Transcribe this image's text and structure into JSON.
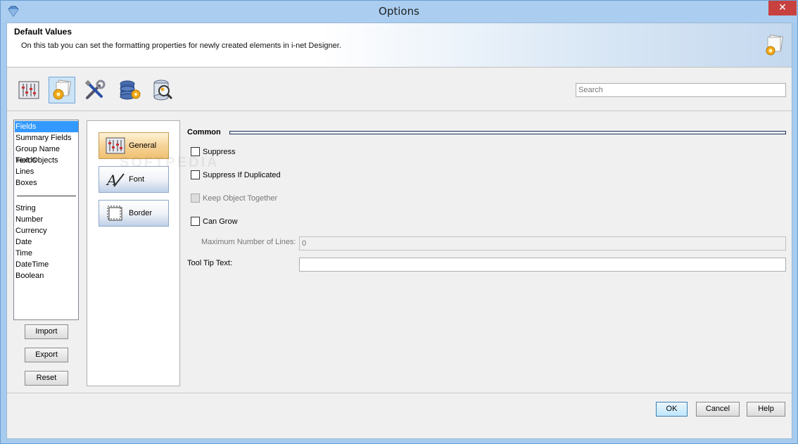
{
  "window": {
    "title": "Options",
    "close_glyph": "✕"
  },
  "header": {
    "title": "Default Values",
    "description": "On this tab you can set the formatting properties for newly created elements in i-net Designer."
  },
  "toolbar": {
    "icons": [
      {
        "name": "sliders-icon",
        "selected": false
      },
      {
        "name": "default-values-gear-icon",
        "selected": true
      },
      {
        "name": "tools-icon",
        "selected": false
      },
      {
        "name": "database-gear-icon",
        "selected": false
      },
      {
        "name": "database-search-icon",
        "selected": false
      }
    ],
    "search_placeholder": "Search"
  },
  "element_list": {
    "items": [
      "Fields",
      "Summary Fields",
      "Group Name Fields",
      "Text Objects",
      "Lines",
      "Boxes"
    ],
    "types": [
      "String",
      "Number",
      "Currency",
      "Date",
      "Time",
      "DateTime",
      "Boolean"
    ],
    "selected": "Fields"
  },
  "list_buttons": {
    "import": "Import",
    "export": "Export",
    "reset": "Reset"
  },
  "categories": [
    {
      "label": "General",
      "icon": "sliders-icon",
      "selected": true
    },
    {
      "label": "Font",
      "icon": "font-icon",
      "selected": false
    },
    {
      "label": "Border",
      "icon": "border-icon",
      "selected": false
    }
  ],
  "common": {
    "section_title": "Common",
    "suppress": "Suppress",
    "suppress_if_duplicated": "Suppress If Duplicated",
    "keep_object_together": "Keep Object Together",
    "can_grow": "Can Grow",
    "max_lines_label": "Maximum Number of Lines:",
    "max_lines_value": "0",
    "tooltip_label": "Tool Tip Text:",
    "tooltip_value": ""
  },
  "footer": {
    "ok": "OK",
    "cancel": "Cancel",
    "help": "Help"
  },
  "watermark": "SOFTPEDIA",
  "colors": {
    "selection": "#3399ff",
    "title_bar": "#aacdf0",
    "close_button": "#c7413f"
  }
}
